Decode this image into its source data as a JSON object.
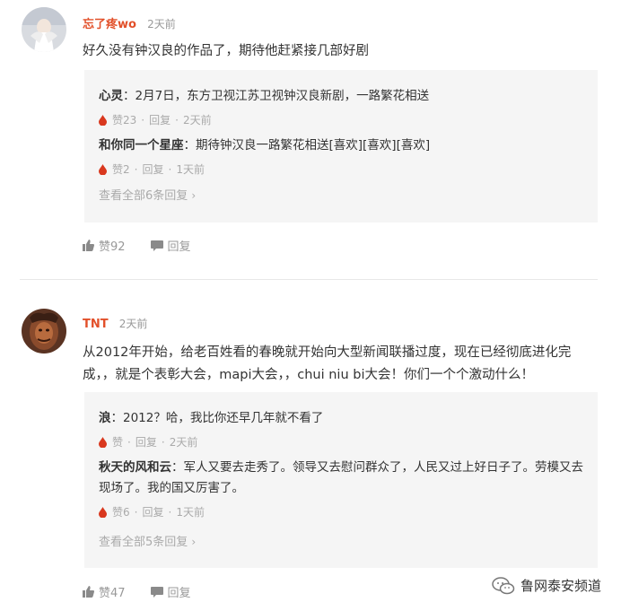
{
  "comments": [
    {
      "username": "忘了疼wo",
      "time": "2天前",
      "text": "好久没有钟汉良的作品了，期待他赶紧接几部好剧",
      "replies": [
        {
          "name": "心灵",
          "text": "：2月7日，东方卫视江苏卫视钟汉良新剧，一路繁花相送",
          "likes": "赞23",
          "reply_label": "回复",
          "time": "2天前"
        },
        {
          "name": "和你同一个星座",
          "text": "：期待钟汉良一路繁花相送[喜欢][喜欢][喜欢]",
          "likes": "赞2",
          "reply_label": "回复",
          "time": "1天前"
        }
      ],
      "view_all": "查看全部6条回复",
      "likes": "赞92",
      "reply_label": "回复"
    },
    {
      "username": "TNT",
      "time": "2天前",
      "text": "从2012年开始，给老百姓看的春晚就开始向大型新闻联播过度，现在已经彻底进化完成，，就是个表彰大会，mapi大会，，chui niu bi大会！你们一个个激动什么！",
      "replies": [
        {
          "name": "浪",
          "text": "：2012？哈，我比你还早几年就不看了",
          "likes": "赞",
          "reply_label": "回复",
          "time": "2天前"
        },
        {
          "name": "秋天的风和云",
          "text": "：军人又要去走秀了。领导又去慰问群众了，人民又过上好日子了。劳模又去现场了。我的国又厉害了。",
          "likes": "赞6",
          "reply_label": "回复",
          "time": "1天前"
        }
      ],
      "view_all": "查看全部5条回复",
      "likes": "赞47",
      "reply_label": "回复"
    }
  ],
  "watermark": "鲁网泰安频道",
  "icons": {
    "like": "thumbs-up-icon",
    "reply": "speech-bubble-icon",
    "reply_like": "red-drop-icon",
    "chevron": "chevron-right-icon",
    "watermark": "wechat-icon"
  },
  "colors": {
    "username": "#e2502a",
    "drop": "#d9381e",
    "muted": "#999999",
    "reply_bg": "#f5f5f5"
  }
}
